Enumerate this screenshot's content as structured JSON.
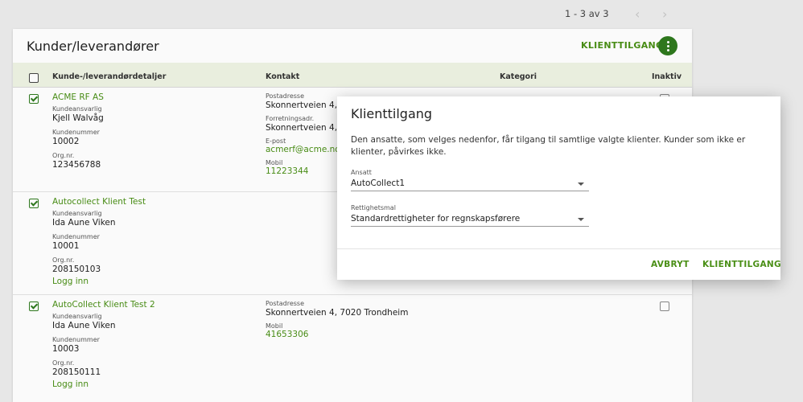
{
  "pager": {
    "text": "1 - 3 av 3",
    "prev_icon": "chevron-left-icon",
    "next_icon": "chevron-right-icon"
  },
  "card": {
    "title": "Kunder/leverandører",
    "action_label": "KLIENTTILGANG",
    "more_icon": "more-vertical-icon",
    "headers": {
      "details": "Kunde-/leverandørdetaljer",
      "contact": "Kontakt",
      "category": "Kategori",
      "inactive": "Inaktiv"
    }
  },
  "rows": [
    {
      "name": "ACME RF AS",
      "responsible_label": "Kundeansvarlig",
      "responsible": "Kjell Walvåg",
      "number_label": "Kundenummer",
      "number": "10002",
      "org_label": "Org.nr.",
      "org": "123456788",
      "login": "",
      "postal_label": "Postadresse",
      "postal": "Skonnertveien 4, 7",
      "business_label": "Forretningsadr.",
      "business": "Skonnertveien 4, 7",
      "email_label": "E-post",
      "email": "acmerf@acme.no",
      "mobile_label": "Mobil",
      "mobile": "11223344",
      "checked": true
    },
    {
      "name": "Autocollect Klient Test",
      "responsible_label": "Kundeansvarlig",
      "responsible": "Ida Aune Viken",
      "number_label": "Kundenummer",
      "number": "10001",
      "org_label": "Org.nr.",
      "org": "208150103",
      "login": "Logg inn",
      "checked": true
    },
    {
      "name": "AutoCollect Klient Test 2",
      "responsible_label": "Kundeansvarlig",
      "responsible": "Ida Aune Viken",
      "number_label": "Kundenummer",
      "number": "10003",
      "org_label": "Org.nr.",
      "org": "208150111",
      "login": "Logg inn",
      "postal_label": "Postadresse",
      "postal": "Skonnertveien 4, 7020 Trondheim",
      "mobile_label": "Mobil",
      "mobile": "41653306",
      "checked": true
    }
  ],
  "dialog": {
    "title": "Klienttilgang",
    "description": "Den ansatte, som velges nedenfor, får tilgang til samtlige valgte klienter. Kunder som ikke er klienter, påvirkes ikke.",
    "employee_label": "Ansatt",
    "employee_value": "AutoCollect1",
    "rights_label": "Rettighetsmal",
    "rights_value": "Standardrettigheter for regnskapsførere",
    "cancel_label": "AVBRYT",
    "confirm_label": "KLIENTTILGANG"
  },
  "colors": {
    "accent": "#4a8f16",
    "accent_dark": "#2f7a1e",
    "header_bg": "#eef3e3"
  }
}
